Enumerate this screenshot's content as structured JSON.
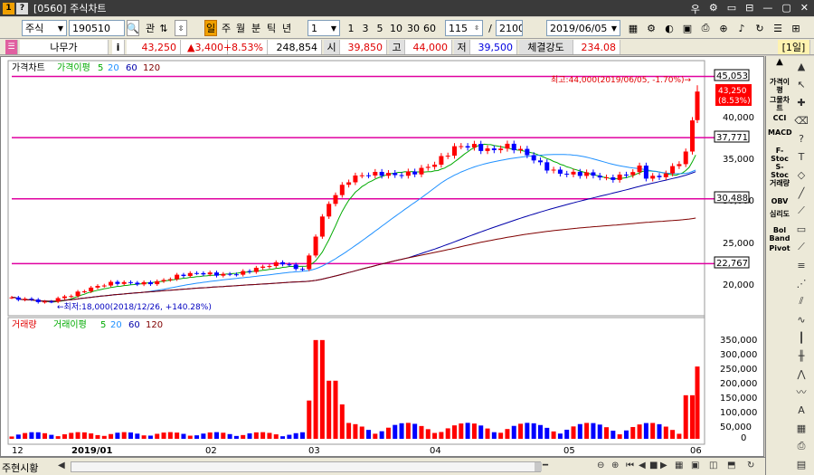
{
  "titlebar": {
    "badge1": "1",
    "badge2": "?",
    "title": "[0560] 주식차트",
    "controls": [
      "우",
      "⚙",
      "▭",
      "⊟",
      "—",
      "▢",
      "✕"
    ]
  },
  "toolbar1": {
    "market": "주식",
    "code": "190510",
    "search_icon": "search-icon",
    "kwan": "관",
    "periods": [
      "주",
      "월",
      "분",
      "틱",
      "년"
    ],
    "count_input": "1",
    "minutes": [
      "1",
      "3",
      "5",
      "10",
      "30",
      "60"
    ],
    "view_count": "115",
    "total_count": "2100",
    "date": "2019/06/05"
  },
  "quote": {
    "name": "나무가",
    "info": "i",
    "price": "43,250",
    "change": "▲3,400",
    "change_pct": "+8.53%",
    "volume": "248,854",
    "open_label": "시",
    "open": "39,850",
    "high_label": "고",
    "high": "44,000",
    "low_label": "저",
    "low": "39,500",
    "strength_label": "체결강도",
    "strength": "234.08",
    "period_tag": "[1일]"
  },
  "price_panel": {
    "legend": [
      "가격차트",
      "가격이평",
      "5",
      "20",
      "60",
      "120"
    ],
    "high_annot": "최고:44,000(2019/06/05, -1.70%)→",
    "low_annot": "←최저:18,000(2018/12/26, +140.28%)",
    "y_ticks": [
      "45,000",
      "40,000",
      "35,000",
      "30,000",
      "25,000",
      "20,000"
    ],
    "hlines": [
      "45,053",
      "37,771",
      "30,488",
      "22,767"
    ],
    "current_price": "43,250",
    "current_pct": "(8.53%)"
  },
  "volume_panel": {
    "legend": [
      "거래량",
      "거래이평",
      "5",
      "20",
      "60",
      "120"
    ],
    "y_ticks": [
      "350,000",
      "300,000",
      "250,000",
      "200,000",
      "150,000",
      "100,000",
      "50,000",
      "0"
    ]
  },
  "x_axis": {
    "labels": [
      "12",
      "2019/01",
      "02",
      "03",
      "04",
      "05",
      "06"
    ]
  },
  "right_toolbar": {
    "items": [
      "가격이평",
      "그물차트",
      "CCI",
      "MACD",
      "F-Stoc",
      "S-Stoc",
      "거래량",
      "OBV",
      "심리도",
      "Bol Band",
      "Pivot"
    ]
  },
  "bottombar": {
    "label": "주현시황"
  },
  "colors": {
    "up": "#ff0000",
    "down": "#0000ff",
    "hline": "#e000a0",
    "ma5": "#00aa00",
    "ma20": "#1e90ff",
    "ma60": "#0000aa",
    "ma120": "#800000"
  },
  "chart_data": {
    "type": "candlestick",
    "dates_labelled": [
      "12",
      "2019/01",
      "02",
      "03",
      "04",
      "05",
      "06"
    ],
    "high": {
      "value": 44000,
      "date": "2019/06/05",
      "pct": -1.7
    },
    "low": {
      "value": 18000,
      "date": "2018/12/26",
      "pct": 140.28
    },
    "last": {
      "close": 43250,
      "open": 39850,
      "high": 44000,
      "low": 39500,
      "volume": 248854
    },
    "horizontal_lines": [
      45053,
      37771,
      30488,
      22767
    ],
    "price_ylim": [
      17000,
      46500
    ],
    "volume_ylim": [
      0,
      380000
    ]
  }
}
